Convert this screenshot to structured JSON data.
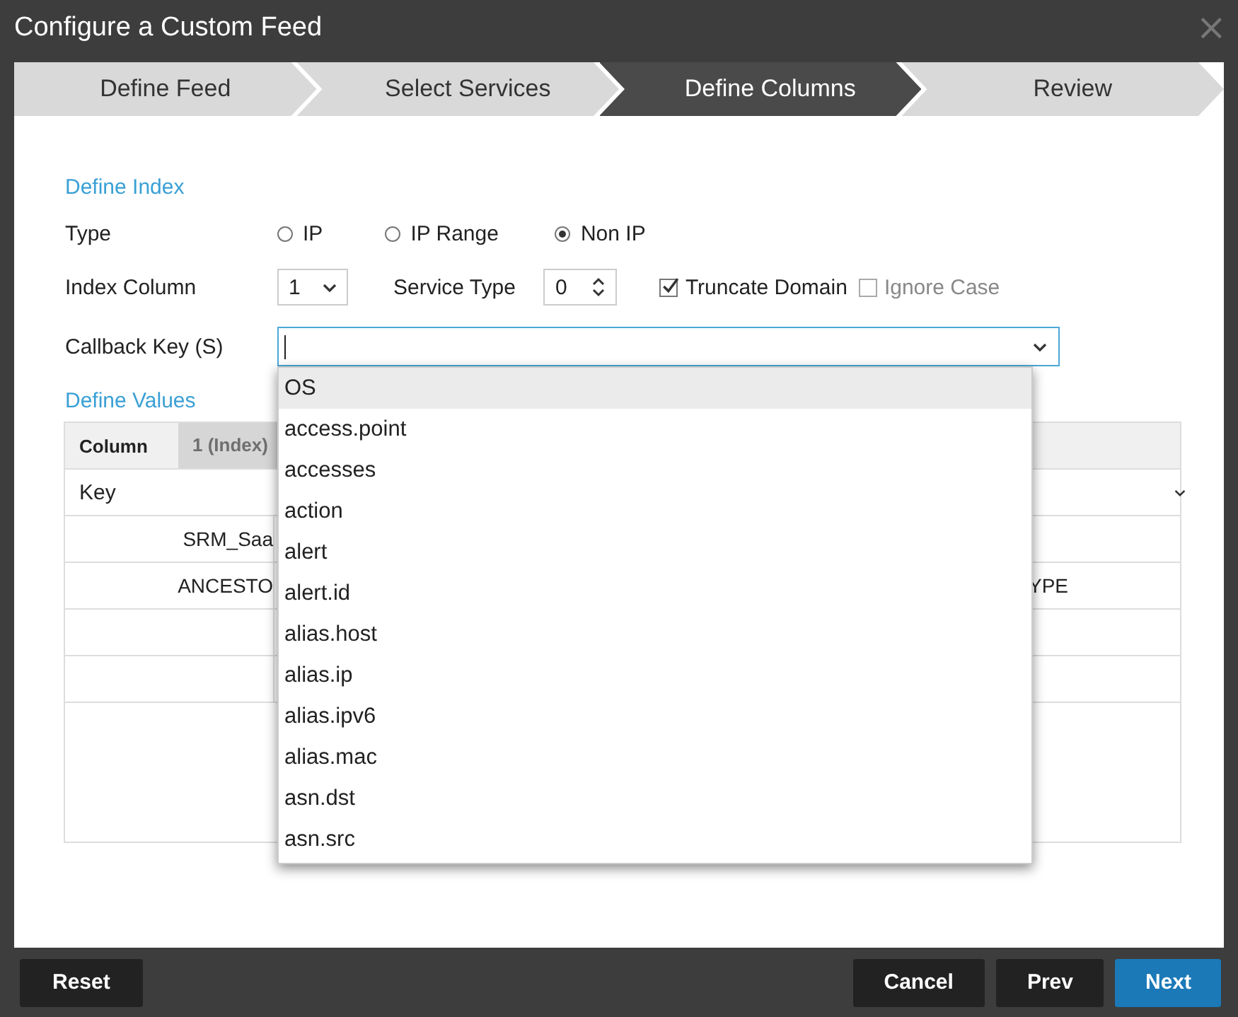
{
  "window": {
    "title": "Configure a Custom Feed",
    "close": "×"
  },
  "steps": [
    {
      "label": "Define Feed",
      "selected": false
    },
    {
      "label": "Select Services",
      "selected": false
    },
    {
      "label": "Define Columns",
      "selected": true
    },
    {
      "label": "Review",
      "selected": false
    }
  ],
  "define_index": {
    "heading": "Define Index",
    "type_label": "Type",
    "type_options": [
      {
        "label": "IP",
        "selected": false
      },
      {
        "label": "IP Range",
        "selected": false
      },
      {
        "label": "Non IP",
        "selected": true
      }
    ],
    "index_column_label": "Index Column",
    "index_column_value": "1",
    "service_type_label": "Service Type",
    "service_type_value": "0",
    "checkboxes": [
      {
        "label": "Truncate Domain",
        "checked": true,
        "disabled": false
      },
      {
        "label": "Ignore Case",
        "checked": false,
        "disabled": true
      }
    ],
    "callback_label": "Callback Key (S)",
    "callback_options": [
      {
        "label": "OS",
        "selected": true
      },
      {
        "label": "access.point",
        "selected": false
      },
      {
        "label": "accesses",
        "selected": false
      },
      {
        "label": "action",
        "selected": false
      },
      {
        "label": "alert",
        "selected": false
      },
      {
        "label": "alert.id",
        "selected": false
      },
      {
        "label": "alias.host",
        "selected": false
      },
      {
        "label": "alias.ip",
        "selected": false
      },
      {
        "label": "alias.ipv6",
        "selected": false
      },
      {
        "label": "alias.mac",
        "selected": false
      },
      {
        "label": "asn.dst",
        "selected": false
      },
      {
        "label": "asn.src",
        "selected": false
      }
    ]
  },
  "define_values": {
    "heading": "Define Values",
    "header": [
      "Column",
      "1 (Index)"
    ],
    "key_label": "Key",
    "rows": [
      {
        "column_1": "SRM_Saa"
      },
      {
        "column_1": "ANCESTO",
        "column_3": "YPE"
      },
      {},
      {}
    ]
  },
  "footer": {
    "left_buttons": [
      {
        "label": "Reset",
        "primary": false
      }
    ],
    "right_buttons": [
      {
        "label": "Cancel",
        "primary": false
      },
      {
        "label": "Prev",
        "primary": false
      },
      {
        "label": "Next",
        "primary": true
      }
    ]
  }
}
